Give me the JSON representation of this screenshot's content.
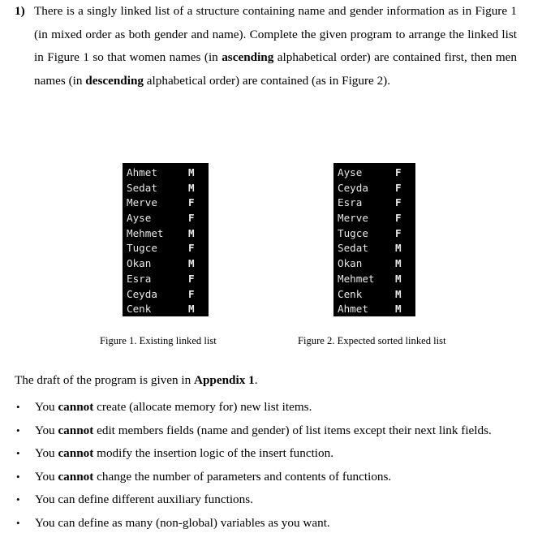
{
  "question": {
    "number": "1)",
    "segments": [
      {
        "text": "There is a singly linked list of a structure containing name and gender information as in Figure 1 (in mixed order as both gender and name). Complete the given program to arrange the linked list in Figure 1 so that women names (in ",
        "bold": false
      },
      {
        "text": "ascending",
        "bold": true
      },
      {
        "text": " alphabetical order) are contained first, then men names (in ",
        "bold": false
      },
      {
        "text": "descending",
        "bold": true
      },
      {
        "text": " alphabetical order) are contained (as in Figure 2).",
        "bold": false
      }
    ]
  },
  "figure1": {
    "caption": "Figure 1. Existing linked list",
    "rows": [
      {
        "name": "Ahmet",
        "gender": "M"
      },
      {
        "name": "Sedat",
        "gender": "M"
      },
      {
        "name": "Merve",
        "gender": "F"
      },
      {
        "name": "Ayse",
        "gender": "F"
      },
      {
        "name": "Mehmet",
        "gender": "M"
      },
      {
        "name": "Tugce",
        "gender": "F"
      },
      {
        "name": "Okan",
        "gender": "M"
      },
      {
        "name": "Esra",
        "gender": "F"
      },
      {
        "name": "Ceyda",
        "gender": "F"
      },
      {
        "name": "Cenk",
        "gender": "M"
      }
    ]
  },
  "figure2": {
    "caption": "Figure 2. Expected sorted linked list",
    "rows": [
      {
        "name": "Ayse",
        "gender": "F"
      },
      {
        "name": "Ceyda",
        "gender": "F"
      },
      {
        "name": "Esra",
        "gender": "F"
      },
      {
        "name": "Merve",
        "gender": "F"
      },
      {
        "name": "Tugce",
        "gender": "F"
      },
      {
        "name": "Sedat",
        "gender": "M"
      },
      {
        "name": "Okan",
        "gender": "M"
      },
      {
        "name": "Mehmet",
        "gender": "M"
      },
      {
        "name": "Cenk",
        "gender": "M"
      },
      {
        "name": "Ahmet",
        "gender": "M"
      }
    ]
  },
  "appendix": {
    "segments": [
      {
        "text": "The draft of the program is given in ",
        "bold": false
      },
      {
        "text": "Appendix 1",
        "bold": true
      },
      {
        "text": ".",
        "bold": false
      }
    ]
  },
  "rules": {
    "bullet_glyph": "•",
    "items": [
      [
        {
          "text": "You ",
          "bold": false
        },
        {
          "text": "cannot",
          "bold": true
        },
        {
          "text": " create (allocate memory for) new list items.",
          "bold": false
        }
      ],
      [
        {
          "text": "You ",
          "bold": false
        },
        {
          "text": "cannot",
          "bold": true
        },
        {
          "text": " edit members fields (name and gender) of list items except their next link fields.",
          "bold": false
        }
      ],
      [
        {
          "text": "You ",
          "bold": false
        },
        {
          "text": "cannot",
          "bold": true
        },
        {
          "text": " modify the insertion logic of the insert function.",
          "bold": false
        }
      ],
      [
        {
          "text": "You ",
          "bold": false
        },
        {
          "text": "cannot",
          "bold": true
        },
        {
          "text": " change the number of parameters and contents of functions.",
          "bold": false
        }
      ],
      [
        {
          "text": "You can define different auxiliary functions.",
          "bold": false
        }
      ],
      [
        {
          "text": "You can define as many (non-global) variables as you want.",
          "bold": false
        }
      ]
    ]
  },
  "colors": {
    "page_background": "#ffffff",
    "text": "#000000",
    "terminal_background": "#000000",
    "terminal_text": "#e8e8e8"
  }
}
